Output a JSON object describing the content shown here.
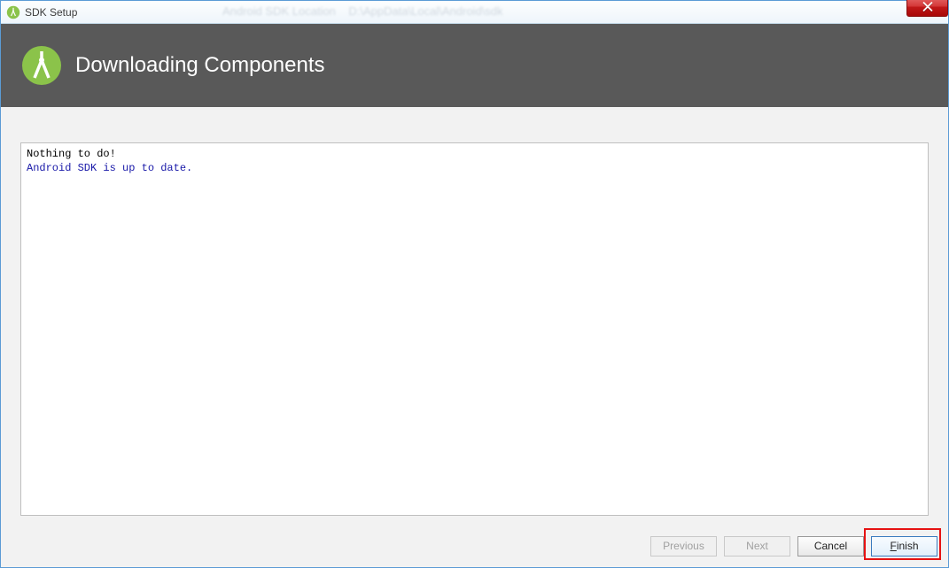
{
  "title": "SDK Setup",
  "header": {
    "title": "Downloading Components"
  },
  "log": {
    "lines": [
      {
        "text": "Nothing to do!",
        "style": "black"
      },
      {
        "text": "Android SDK is up to date.",
        "style": "blue"
      }
    ]
  },
  "footer": {
    "previous_label": "Previous",
    "next_label": "Next",
    "cancel_label": "Cancel",
    "finish_label": "Finish"
  }
}
